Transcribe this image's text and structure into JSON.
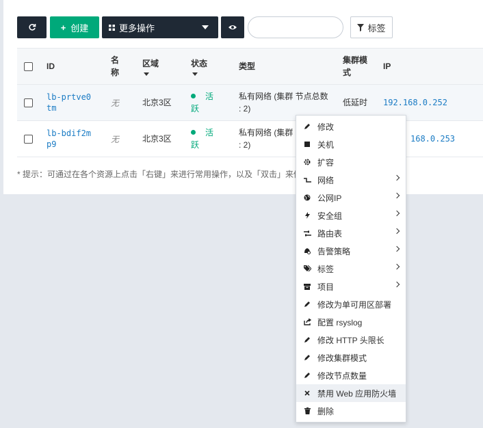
{
  "toolbar": {
    "create_label": "创建",
    "more_label": "更多操作",
    "tag_label": "标签",
    "search_value": ""
  },
  "table": {
    "headers": {
      "id": "ID",
      "name_1": "名",
      "name_2": "称",
      "region": "区域",
      "status": "状态",
      "type": "类型",
      "cluster_1": "集群模",
      "cluster_2": "式",
      "ip": "IP"
    },
    "rows": [
      {
        "id_1": "lb-prtve0",
        "id_2": "tm",
        "name": "无",
        "region": "北京3区",
        "status_1": "活",
        "status_2": "跃",
        "type_1": "私有网络 (集群 节点总数",
        "type_2": ": 2)",
        "cluster": "低延时",
        "ip": "192.168.0.252"
      },
      {
        "id_1": "lb-bdif2m",
        "id_2": "p9",
        "name": "无",
        "region": "北京3区",
        "status_1": "活",
        "status_2": "跃",
        "type_1": "私有网络 (集群",
        "type_2": ": 2)",
        "ip": "168.0.253"
      }
    ]
  },
  "hint": "* 提示：可通过在各个资源上点击「右键」来进行常用操作，以及「双击」来修",
  "context_menu": {
    "items": [
      {
        "label": "修改",
        "icon": "pencil-icon"
      },
      {
        "label": "关机",
        "icon": "stop-icon"
      },
      {
        "label": "扩容",
        "icon": "gear-icon"
      },
      {
        "label": "网络",
        "icon": "network-icon"
      },
      {
        "label": "公网IP",
        "icon": "globe-icon"
      },
      {
        "label": "安全组",
        "icon": "bolt-icon"
      },
      {
        "label": "路由表",
        "icon": "route-icon"
      },
      {
        "label": "告警策略",
        "icon": "alarm-icon"
      },
      {
        "label": "标签",
        "icon": "tags-icon"
      },
      {
        "label": "项目",
        "icon": "archive-icon"
      },
      {
        "label": "修改为单可用区部署",
        "icon": "pencil-icon"
      },
      {
        "label": "配置 rsyslog",
        "icon": "share-icon"
      },
      {
        "label": "修改 HTTP 头限长",
        "icon": "pencil-icon"
      },
      {
        "label": "修改集群模式",
        "icon": "pencil-icon"
      },
      {
        "label": "修改节点数量",
        "icon": "pencil-icon"
      },
      {
        "label": "禁用 Web 应用防火墙",
        "icon": "close-icon"
      },
      {
        "label": "删除",
        "icon": "trash-icon"
      }
    ]
  }
}
